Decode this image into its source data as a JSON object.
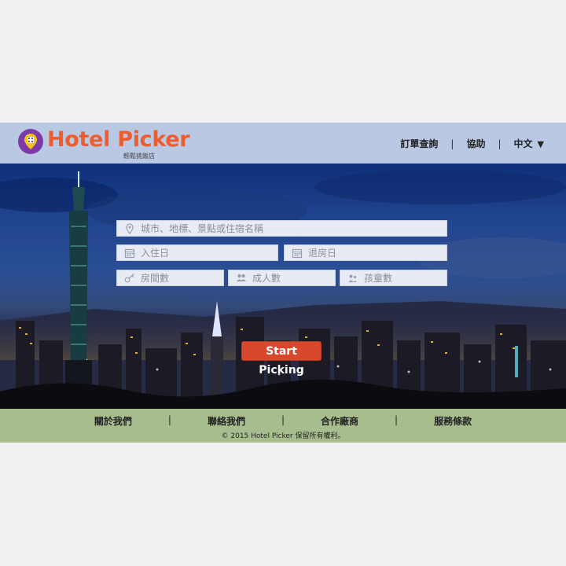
{
  "brand": {
    "name": "Hotel Picker",
    "tagline": "輕鬆挑飯店",
    "badge_color": "#7d3aa8",
    "name_color": "#ef5d2e"
  },
  "nav": {
    "items": [
      {
        "label": "訂單查詢"
      },
      {
        "label": "協助"
      },
      {
        "label": "中文"
      }
    ],
    "lang_caret": "▼"
  },
  "search": {
    "destination_placeholder": "城市、地標、景點或住宿名稱",
    "checkin_placeholder": "入住日",
    "checkout_placeholder": "退房日",
    "rooms_placeholder": "房間數",
    "adults_placeholder": "成人數",
    "children_placeholder": "孩童數",
    "submit_label": "Start Picking",
    "submit_color": "#d9482d"
  },
  "footer": {
    "links": [
      {
        "label": "關於我們"
      },
      {
        "label": "聯絡我們"
      },
      {
        "label": "合作廠商"
      },
      {
        "label": "服務條款"
      }
    ],
    "separator": "|",
    "copyright": "© 2015 Hotel Picker 保留所有權利。",
    "background": "#a8bd8e"
  }
}
